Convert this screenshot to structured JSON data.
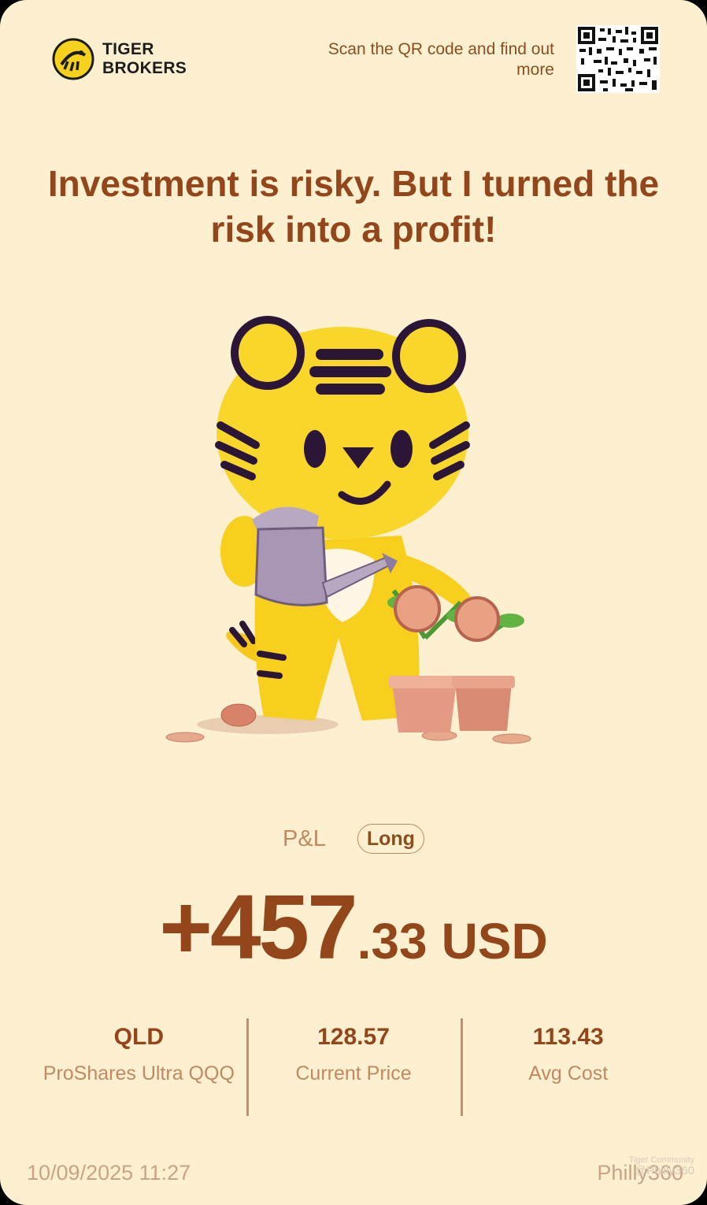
{
  "brand": {
    "line1": "TIGER",
    "line2": "BROKERS"
  },
  "header": {
    "scan_text": "Scan the QR code and find out more"
  },
  "headline": "Investment is risky. But I turned the risk into a profit!",
  "pnl": {
    "label": "P&L",
    "position_badge": "Long",
    "amount_main": "+457",
    "amount_fraction": ".33",
    "currency": "USD"
  },
  "stats": [
    {
      "value": "QLD",
      "label": "ProShares Ultra QQQ"
    },
    {
      "value": "128.57",
      "label": "Current Price"
    },
    {
      "value": "113.43",
      "label": "Avg Cost"
    }
  ],
  "footer": {
    "timestamp": "10/09/2025 11:27",
    "username": "Philly360"
  },
  "watermark": {
    "community": "Tiger Community",
    "handle": "@Philly360"
  },
  "colors": {
    "background": "#fdf0d1",
    "accent": "#93461a",
    "muted": "#c08a61",
    "tiger_yellow": "#f7d21c"
  },
  "icons": [
    "tiger-logo-icon",
    "qr-code",
    "tiger-mascot-illustration"
  ]
}
